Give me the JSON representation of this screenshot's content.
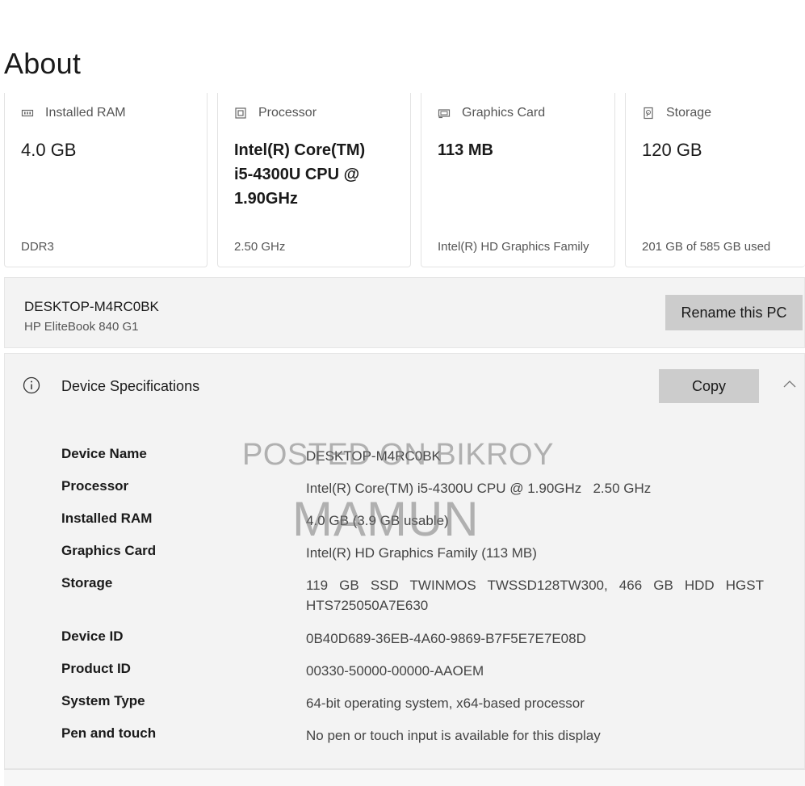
{
  "page": {
    "title": "About"
  },
  "cards": [
    {
      "icon": "ram-icon",
      "label": "Installed RAM",
      "value": "4.0 GB",
      "sub": "DDR3"
    },
    {
      "icon": "processor-icon",
      "label": "Processor",
      "value": "Intel(R) Core(TM) i5-4300U CPU @ 1.90GHz",
      "sub": "2.50 GHz"
    },
    {
      "icon": "graphics-card-icon",
      "label": "Graphics Card",
      "value": "113 MB",
      "sub": "Intel(R) HD Graphics Family"
    },
    {
      "icon": "storage-icon",
      "label": "Storage",
      "value": "120 GB",
      "sub": "201 GB of 585 GB used"
    }
  ],
  "pc": {
    "name": "DESKTOP-M4RC0BK",
    "model": "HP EliteBook 840 G1",
    "rename_label": "Rename this PC"
  },
  "specs": {
    "title": "Device Specifications",
    "copy_label": "Copy",
    "rows": [
      {
        "label": "Device Name",
        "value": "DESKTOP-M4RC0BK"
      },
      {
        "label": "Processor",
        "value": "Intel(R) Core(TM) i5-4300U CPU @ 1.90GHz   2.50 GHz"
      },
      {
        "label": "Installed RAM",
        "value": "4.0 GB (3.9 GB usable)"
      },
      {
        "label": "Graphics Card",
        "value": "Intel(R) HD Graphics Family (113 MB)"
      },
      {
        "label": "Storage",
        "value": "119 GB SSD TWINMOS TWSSD128TW300, 466 GB HDD HGST HTS725050A7E630"
      },
      {
        "label": "Device ID",
        "value": "0B40D689-36EB-4A60-9869-B7F5E7E7E08D"
      },
      {
        "label": "Product ID",
        "value": "00330-50000-00000-AAOEM"
      },
      {
        "label": "System Type",
        "value": "64-bit operating system, x64-based processor"
      },
      {
        "label": "Pen and touch",
        "value": "No pen or touch input is available for this display"
      }
    ]
  },
  "watermark": {
    "line1": "POSTED ON BIKROY",
    "line2": "MAMUN"
  },
  "colors": {
    "panel": "#f3f3f3",
    "button": "#cccccc",
    "text": "#1a1a1a",
    "muted": "#555555"
  }
}
